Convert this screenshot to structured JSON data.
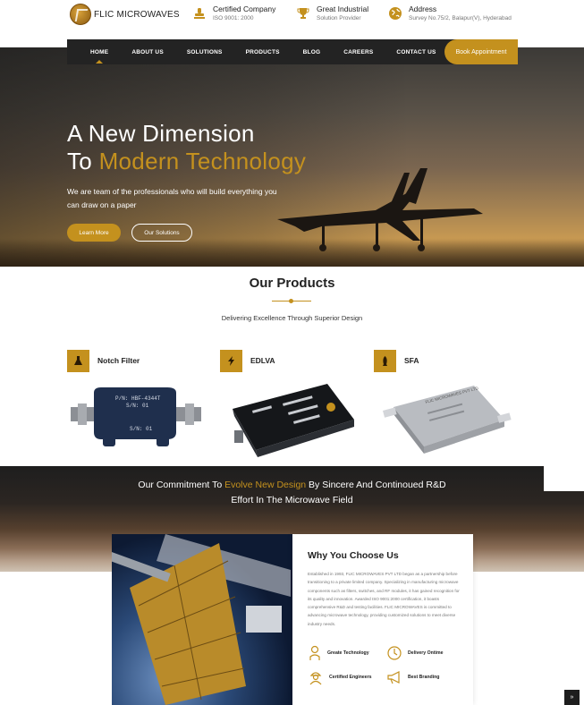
{
  "brand": {
    "name": "FLIC MICROWAVES"
  },
  "topinfo": [
    {
      "icon": "stamp-icon",
      "title": "Certified Company",
      "subtitle": "ISO 9001: 2000"
    },
    {
      "icon": "trophy-icon",
      "title": "Great Industrial",
      "subtitle": "Solution Provider"
    },
    {
      "icon": "globe-icon",
      "title": "Address",
      "subtitle": "Survey No.75/2, Balapur(V), Hyderabad"
    }
  ],
  "nav": {
    "items": [
      "HOME",
      "ABOUT US",
      "SOLUTIONS",
      "PRODUCTS",
      "BLOG",
      "CAREERS",
      "CONTACT US"
    ],
    "active": "HOME",
    "cta": "Book Appointment"
  },
  "hero": {
    "line1": "A New Dimension",
    "line2_prefix": "To ",
    "line2_highlight": "Modern Technology",
    "paragraph": "We are team of the professionals who will build everything you can draw on a paper",
    "primary_button": "Learn More",
    "secondary_button": "Our Solutions"
  },
  "products": {
    "title": "Our Products",
    "subtitle": "Delivering Excellence Through Superior Design",
    "items": [
      {
        "name": "Notch Filter",
        "icon": "flask-icon",
        "label_top": "P/N: HBF-4344T",
        "label_mid": "S/N: 01",
        "label_bottom": "S/N: 01"
      },
      {
        "name": "EDLVA",
        "icon": "bolt-icon",
        "label_top": "",
        "label_mid": "",
        "label_bottom": ""
      },
      {
        "name": "SFA",
        "icon": "rocket-icon",
        "label_top": "FLIC MICROWAVES PVT LTD",
        "label_mid": "",
        "label_bottom": ""
      }
    ]
  },
  "commitment": {
    "prefix": "Our Commitment To ",
    "highlight": "Evolve New Design",
    "suffix": " By Sincere And Continoued R&D",
    "line2": "Effort In The Microwave Field"
  },
  "why": {
    "title": "Why You Choose Us",
    "body": "Established in 1993, FLIC MICROWAVES PVT LTD began as a partnership before transitioning to a private limited company. Specializing in manufacturing microwave components such as filters, switches, and RF modules, it has gained recognition for its quality and innovation. Awarded ISO 9001:2000 certification, it boasts comprehensive R&D and testing facilities. FLIC MICROWAVES is committed to advancing microwave technology, providing customized solutions to meet diverse industry needs.",
    "features": [
      {
        "label": "Greate Technology",
        "icon": "lightbulb-person-icon"
      },
      {
        "label": "Delivery Ontime",
        "icon": "clock-icon"
      },
      {
        "label": "Certified Engineers",
        "icon": "engineer-icon"
      },
      {
        "label": "Best Branding",
        "icon": "megaphone-icon"
      }
    ]
  },
  "scroll_top": {
    "glyph": "»"
  },
  "colors": {
    "accent": "#c4911e",
    "dark": "#232323"
  }
}
